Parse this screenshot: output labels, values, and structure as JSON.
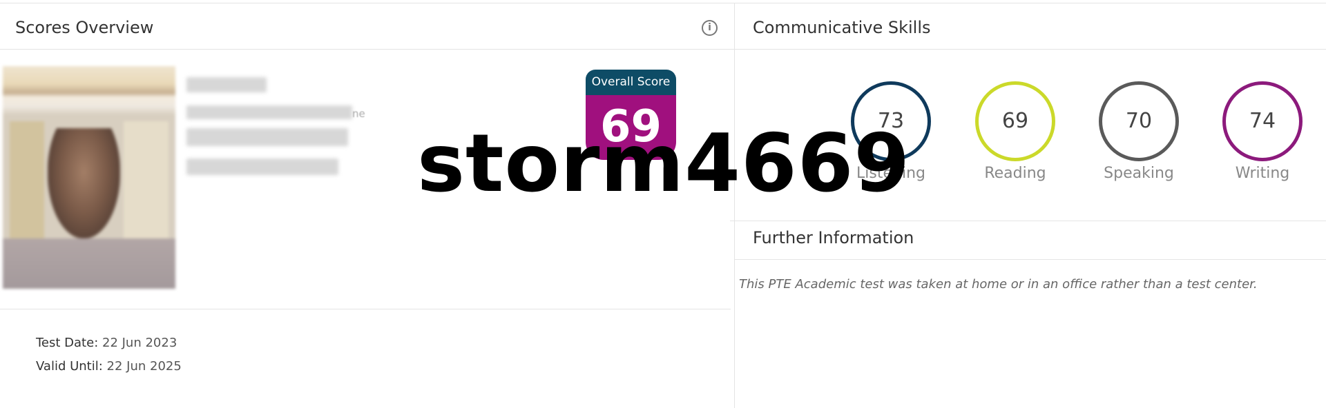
{
  "scores_overview": {
    "title": "Scores Overview",
    "info_icon": "info-icon",
    "overall_score_label": "Overall Score",
    "overall_score_value": "69",
    "test_date_label": "Test Date:",
    "test_date_value": "22 Jun 2023",
    "valid_until_label": "Valid Until:",
    "valid_until_value": "22 Jun 2025",
    "identity_fragment": "ne"
  },
  "communicative_skills": {
    "title": "Communicative Skills",
    "skills": [
      {
        "label": "Listening",
        "score": "73",
        "color": "#0f3a5c"
      },
      {
        "label": "Reading",
        "score": "69",
        "color": "#cbd92a"
      },
      {
        "label": "Speaking",
        "score": "70",
        "color": "#5a5a5a"
      },
      {
        "label": "Writing",
        "score": "74",
        "color": "#8c1a7c"
      }
    ]
  },
  "further_information": {
    "title": "Further Information",
    "text": "This PTE Academic test was taken at home or in an office rather than a test center."
  },
  "watermark": {
    "text": "storm4669"
  },
  "colors": {
    "badge_top": "#0e4c66",
    "badge_bottom": "#a0107e"
  }
}
